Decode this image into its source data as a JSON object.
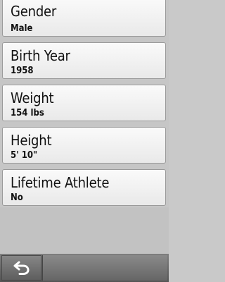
{
  "settings": {
    "items": [
      {
        "label": "Gender",
        "value": "Male"
      },
      {
        "label": "Birth Year",
        "value": "1958"
      },
      {
        "label": "Weight",
        "value": "154 lbs"
      },
      {
        "label": "Height",
        "value": "5' 10\""
      },
      {
        "label": "Lifetime Athlete",
        "value": "No"
      }
    ]
  },
  "toolbar": {
    "back_icon": "back-arrow-icon"
  },
  "colors": {
    "row_bg": "#f4f4f4",
    "row_border": "#9a9a9a",
    "screen_bg": "#c6c6c6",
    "toolbar_bg": "#666666"
  }
}
